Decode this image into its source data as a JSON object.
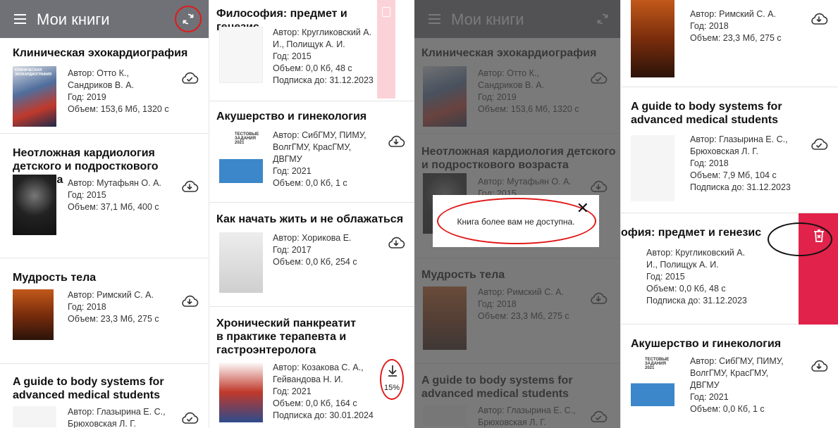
{
  "app": {
    "title": "Мои книги"
  },
  "icons": {
    "menu": "hamburger-icon",
    "sync": "sync-icon",
    "cloud": "cloud-download-icon",
    "cloud_done": "cloud-check-icon",
    "download": "download-arrow-icon",
    "trash": "trash-icon",
    "close": "close-icon"
  },
  "colors": {
    "appbar": "#6f7177",
    "highlight": "#e11a1a",
    "delete": "#e1224a"
  },
  "panel1": {
    "books": [
      {
        "title": "Клиническая эхокардиография",
        "author": "Автор: Отто К., Сандриков В. А.",
        "year": "Год: 2019",
        "size": "Объем: 153,6 Мб, 1320 с",
        "cover_text": "КЛИНИЧЕСКАЯ ЭХОКАРДИОГРАФИЯ"
      },
      {
        "title": "Неотложная кардиология детского и подросткового возраста",
        "author": "Автор: Мутафьян О. А.",
        "year": "Год: 2015",
        "size": "Объем: 37,1 Мб, 400 с"
      },
      {
        "title": "Мудрость тела",
        "author": "Автор: Римский С. А.",
        "year": "Год: 2018",
        "size": "Объем: 23,3 Мб, 275 с"
      },
      {
        "title": "A guide to body systems for advanced medical students",
        "author": "Автор: Глазырина Е. С., Брюховская Л. Г."
      }
    ]
  },
  "panel2": {
    "books": [
      {
        "title": "Философия: предмет и генезис",
        "author": "Автор: Кругликовский А. И., Полищук А. И.",
        "year": "Год: 2015",
        "size": "Объем: 0,0 Кб, 48 с",
        "sub": "Подписка до: 31.12.2023"
      },
      {
        "title": "Акушерство и гинекология",
        "author": "Автор: СибГМУ, ПИМУ, ВолгГМУ, КрасГМУ, ДВГМУ",
        "year": "Год: 2021",
        "size": "Объем: 0,0 Кб, 1 с",
        "cover_text": "ТЕСТОВЫЕ ЗАДАНИЯ 2021"
      },
      {
        "title": "Как начать жить и не облажаться",
        "author": "Автор: Хорикова Е.",
        "year": "Год: 2017",
        "size": "Объем: 0,0 Кб, 254 с"
      },
      {
        "title": "Хронический панкреатит в практике терапевта и гастроэнтеролога",
        "author": "Автор: Козакова С. А., Гейвандова Н. И.",
        "year": "Год: 2021",
        "size": "Объем: 0,0 Кб, 164 с",
        "sub": "Подписка до: 30.01.2024"
      }
    ],
    "download_progress": 15,
    "download_label": "15%"
  },
  "panel3": {
    "dialog_text": "Книга более вам не доступна."
  },
  "panel4": {
    "books": [
      {
        "author": "Автор: Римский С. А.",
        "year": "Год: 2018",
        "size": "Объем: 23,3 Мб, 275 с"
      },
      {
        "title": "A guide to body systems for advanced medical students",
        "author": "Автор: Глазырина Е. С., Брюховская Л. Г.",
        "year": "Год: 2018",
        "size": "Объем: 7,9 Мб, 104 с",
        "sub": "Подписка до: 31.12.2023"
      },
      {
        "title": "офия: предмет и генезис",
        "author": "Автор: Кругликовский А. И., Полищук А. И.",
        "year": "Год: 2015",
        "size": "Объем: 0,0 Кб, 48 с",
        "sub": "Подписка до: 31.12.2023"
      },
      {
        "title": "Акушерство и гинекология",
        "author": "Автор: СибГМУ, ПИМУ, ВолгГМУ, КрасГМУ, ДВГМУ",
        "year": "Год: 2021",
        "size": "Объем: 0,0 Кб, 1 с",
        "cover_text": "ТЕСТОВЫЕ ЗАДАНИЯ 2021"
      }
    ]
  }
}
